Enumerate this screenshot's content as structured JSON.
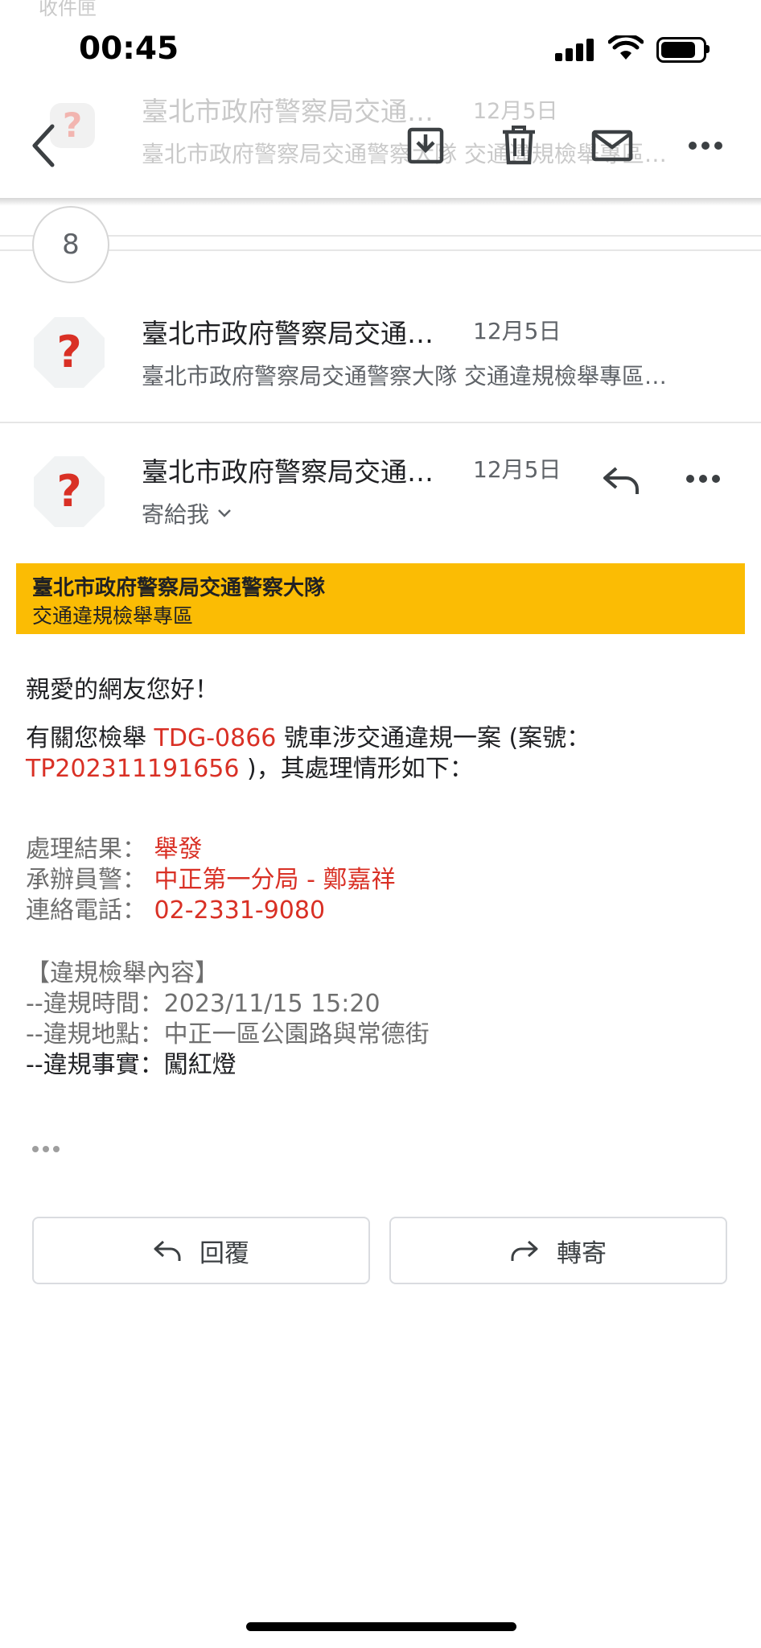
{
  "background": {
    "ghost_label": "收件匣",
    "ghost_sender": "臺北市政府警察局交通…",
    "ghost_date": "12月5日",
    "ghost_preview": "臺北市政府警察局交通警察大隊 交通違規檢舉專區…"
  },
  "status_bar": {
    "time": "00:45"
  },
  "thread": {
    "collapsed_count": "8",
    "collapsed_message": {
      "sender": "臺北市政府警察局交通…",
      "date": "12月5日",
      "preview": "臺北市政府警察局交通警察大隊 交通違規檢舉專區…"
    },
    "open_message": {
      "sender": "臺北市政府警察局交通…",
      "date": "12月5日",
      "to": "寄給我"
    }
  },
  "email": {
    "banner_title": "臺北市政府警察局交通警察大隊",
    "banner_subtitle": "交通違規檢舉專區",
    "greeting": "親愛的網友您好！",
    "intro_1": "有關您檢舉 ",
    "plate": "TDG-0866",
    "intro_2": " 號車涉交通違規一案 (案號：",
    "case_no": "TP202311191656",
    "intro_3": " )，其處理情形如下：",
    "result_label": "處理結果：",
    "result_value": "舉發",
    "officer_label": "承辦員警：",
    "officer_value": "中正第一分局 - 鄭嘉祥",
    "phone_label": "連絡電話：",
    "phone_value": "02-2331-9080",
    "section_title": "【違規檢舉內容】",
    "time_line": "--違規時間：2023/11/15 15:20",
    "place_line": "--違規地點：中正一區公園路與常德街",
    "fact_line": "--違規事實：闖紅燈"
  },
  "actions": {
    "reply": "回覆",
    "forward": "轉寄"
  },
  "colors": {
    "banner": "#fbbc04",
    "highlight": "#d93025",
    "avatar_bg": "#f1f3f4",
    "avatar_mark": "#d93025"
  }
}
